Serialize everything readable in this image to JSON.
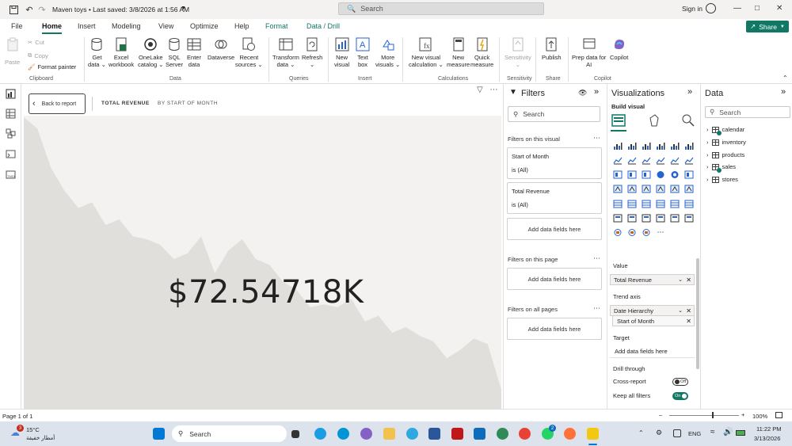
{
  "window": {
    "title": "Maven toys • Last saved: 3/8/2026 at 1:56 AM",
    "search_placeholder": "Search",
    "signin_label": "Sign in"
  },
  "ribbon_tabs": [
    "File",
    "Home",
    "Insert",
    "Modeling",
    "View",
    "Optimize",
    "Help",
    "Format",
    "Data / Drill"
  ],
  "share_label": "Share",
  "ribbon": {
    "clipboard": {
      "paste": "Paste",
      "cut": "Cut",
      "copy": "Copy",
      "format_painter": "Format painter",
      "group": "Clipboard"
    },
    "data": {
      "get_data": [
        "Get",
        "data ⌄"
      ],
      "excel": [
        "Excel",
        "workbook"
      ],
      "onelake": [
        "OneLake",
        "catalog ⌄"
      ],
      "sql": [
        "SQL",
        "Server"
      ],
      "enter": [
        "Enter",
        "data"
      ],
      "dataverse": [
        "Dataverse",
        ""
      ],
      "recent": [
        "Recent",
        "sources ⌄"
      ],
      "group": "Data"
    },
    "queries": {
      "transform": [
        "Transform",
        "data ⌄"
      ],
      "refresh": [
        "Refresh",
        "⌄"
      ],
      "group": "Queries"
    },
    "insert": {
      "new_visual": [
        "New",
        "visual"
      ],
      "text_box": [
        "Text",
        "box"
      ],
      "more_visuals": [
        "More",
        "visuals ⌄"
      ],
      "group": "Insert"
    },
    "calculations": {
      "new_visual_calc": [
        "New visual",
        "calculation ⌄"
      ],
      "new_measure": [
        "New",
        "measure"
      ],
      "quick_measure": [
        "Quick",
        "measure"
      ],
      "group": "Calculations"
    },
    "sensitivity": {
      "label": [
        "Sensitivity",
        "⌄"
      ],
      "group": "Sensitivity"
    },
    "share": {
      "publish": "Publish",
      "group": "Share"
    },
    "copilot": {
      "prep": [
        "Prep data for",
        "AI"
      ],
      "copilot": "Copilot",
      "group": "Copilot"
    }
  },
  "canvas": {
    "back_label": "Back to report",
    "visual_title": "TOTAL REVENUE",
    "visual_subtitle": "BY START OF MONTH",
    "kpi_value": "$72.54718K"
  },
  "chart_data": {
    "type": "area",
    "title": "",
    "xlabel": "",
    "ylabel": "",
    "series": [
      {
        "values": [
          100,
          96,
          82,
          74,
          68,
          70,
          62,
          64,
          58,
          57,
          55,
          50,
          52,
          58,
          45,
          53,
          57,
          50,
          48,
          42,
          39,
          33,
          34,
          33,
          36,
          28,
          30,
          24,
          26,
          23,
          21,
          15,
          18,
          22,
          20,
          4
        ]
      }
    ]
  },
  "filters_pane": {
    "title": "Filters",
    "search_placeholder": "Search",
    "on_this_visual": "Filters on this visual",
    "cards": [
      {
        "field": "Start of Month",
        "value": "is (All)"
      },
      {
        "field": "Total Revenue",
        "value": "is (All)"
      }
    ],
    "add_fields": "Add data fields here",
    "on_this_page": "Filters on this page",
    "on_all_pages": "Filters on all pages"
  },
  "viz_pane": {
    "title": "Visualizations",
    "build_visual": "Build visual",
    "value_label": "Value",
    "value_field": "Total Revenue",
    "trend_label": "Trend axis",
    "trend_fields": [
      "Date Hierarchy",
      "Start of Month"
    ],
    "target_label": "Target",
    "target_placeholder": "Add data fields here",
    "drill_label": "Drill through",
    "cross_report": "Cross-report",
    "cross_report_state": "Off",
    "keep_filters": "Keep all filters",
    "keep_filters_state": "On"
  },
  "data_pane": {
    "title": "Data",
    "search_placeholder": "Search",
    "tables": [
      "calendar",
      "inventory",
      "products",
      "sales",
      "stores"
    ]
  },
  "status_bar": {
    "page": "Page 1 of 1",
    "zoom": "100%"
  },
  "taskbar": {
    "weather_temp": "15°C",
    "weather_desc": "أمطار خفيفة",
    "weather_badge": "3",
    "search": "Search",
    "lang": "ENG",
    "time": "11:22 PM",
    "date": "3/13/2026",
    "whatsapp_badge": "2"
  },
  "colors": {
    "accent": "#117865",
    "card_bg": "#f3f2f1",
    "area_fill": "#e1dfdc"
  }
}
